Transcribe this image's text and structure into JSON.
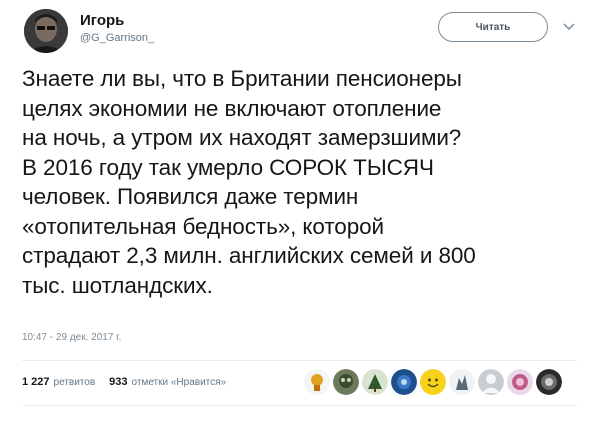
{
  "author": {
    "name": "Игорь",
    "handle": "@G_Garrison_"
  },
  "follow_button": {
    "label": "Читать"
  },
  "tweet": {
    "lines": [
      "Знаете ли вы, что в Британии пенсионеры",
      "целях  экономии не включают отопление",
      "на ночь, а утром их находят  замерзшими?",
      "В 2016 году так умерло СОРОК ТЫСЯЧ",
      "человек. Появился даже термин",
      "«отопительная бедность», которой",
      "страдают 2,3 милн. английских семей и 800",
      "тыс. шотландских."
    ],
    "timestamp": "10:47 - 29 дек. 2017 г."
  },
  "stats": {
    "retweets_count": "1 227",
    "retweets_label": "ретвитов",
    "likes_count": "933",
    "likes_label": "отметки «Нравится»"
  },
  "liker_avatars": [
    "liker-avatar-1",
    "liker-avatar-2",
    "liker-avatar-3",
    "liker-avatar-4",
    "liker-avatar-5",
    "liker-avatar-6",
    "liker-avatar-7",
    "liker-avatar-8",
    "liker-avatar-9"
  ],
  "colors": {
    "text": "#14171a",
    "secondary": "#657786",
    "divider": "#e6ecf0"
  }
}
